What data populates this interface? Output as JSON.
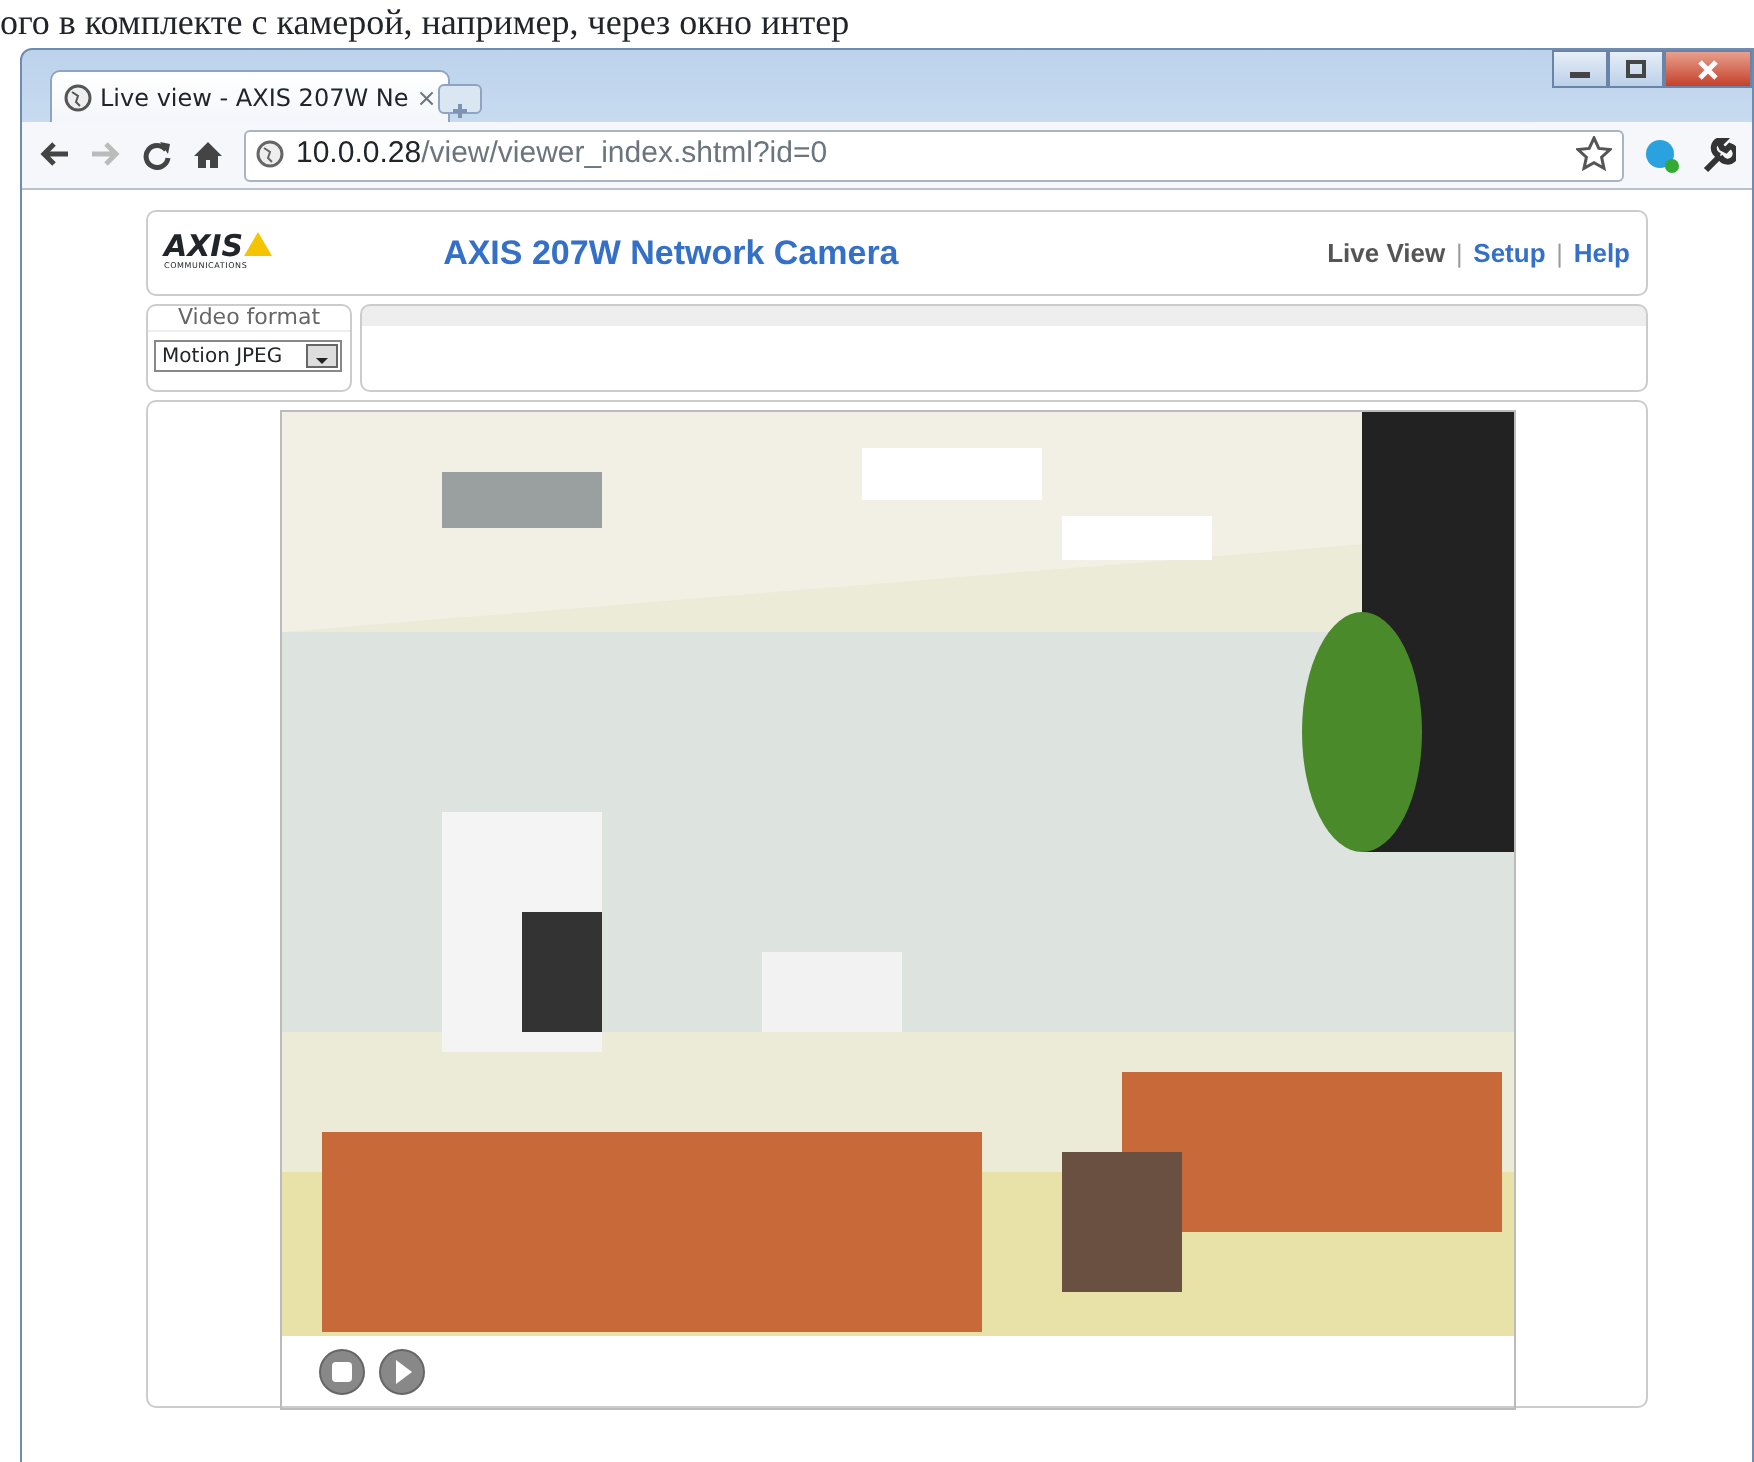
{
  "document_text": "ого в комплекте с камерой, например, через окно интер",
  "browser": {
    "tab": {
      "title": "Live view - AXIS 207W Ne",
      "close": "×"
    },
    "address": {
      "host": "10.0.0.28",
      "path": "/view/viewer_index.shtml?id=0"
    }
  },
  "page": {
    "logo": {
      "word": "AXIS",
      "tagline": "COMMUNICATIONS"
    },
    "title": "AXIS 207W Network Camera",
    "nav": [
      {
        "label": "Live View",
        "selected": true
      },
      {
        "label": "Setup",
        "selected": false
      },
      {
        "label": "Help",
        "selected": false
      }
    ],
    "nav_separators": [
      "|",
      "|"
    ],
    "video_format": {
      "label": "Video format",
      "value": "Motion JPEG"
    },
    "video": {
      "kind": "picture"
    },
    "controls": [
      {
        "kind": "stop"
      },
      {
        "kind": "play"
      }
    ]
  }
}
